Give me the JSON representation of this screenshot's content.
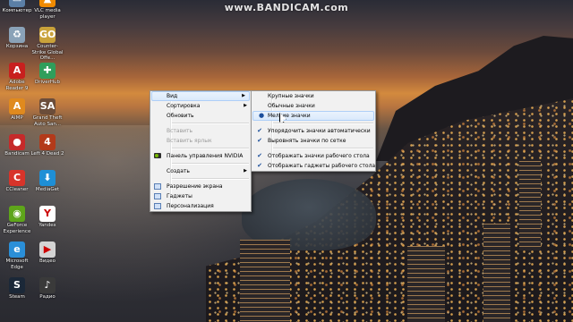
{
  "watermark": "www.BANDICAM.com",
  "desktop_icons": [
    {
      "label": "Компьютер",
      "icon": "computer-icon",
      "color": "#5b7fa6",
      "glyph": "▭"
    },
    {
      "label": "VLC media player",
      "icon": "vlc-icon",
      "color": "#f08a00",
      "glyph": "▲"
    },
    {
      "label": "Корзина",
      "icon": "recycle-bin-icon",
      "color": "#8aa2b8",
      "glyph": "♻"
    },
    {
      "label": "Counter-Strike Global Offe...",
      "icon": "counter-strike-icon",
      "color": "#c9a23a",
      "glyph": "GO"
    },
    {
      "label": "Adobe Reader 9",
      "icon": "adobe-reader-icon",
      "color": "#c8201e",
      "glyph": "A"
    },
    {
      "label": "DriverHub",
      "icon": "driverhub-icon",
      "color": "#2f9e5b",
      "glyph": "✚"
    },
    {
      "label": "AIMP",
      "icon": "aimp-icon",
      "color": "#e08a1e",
      "glyph": "A"
    },
    {
      "label": "Grand Theft Auto San...",
      "icon": "gta-icon",
      "color": "#6b4d3a",
      "glyph": "SA"
    },
    {
      "label": "Bandicam",
      "icon": "bandicam-icon",
      "color": "#c62a2a",
      "glyph": "●"
    },
    {
      "label": "Left 4 Dead 2",
      "icon": "left4dead-icon",
      "color": "#b33a1a",
      "glyph": "4"
    },
    {
      "label": "CCleaner",
      "icon": "ccleaner-icon",
      "color": "#d8342a",
      "glyph": "C"
    },
    {
      "label": "MediaGet",
      "icon": "mediaget-icon",
      "color": "#1e8fd6",
      "glyph": "⬇"
    },
    {
      "label": "GeForce Experience",
      "icon": "geforce-icon",
      "color": "#5ea51a",
      "glyph": "◉"
    },
    {
      "label": "Yandex",
      "icon": "yandex-icon",
      "color": "#ffffff",
      "glyph": "Y"
    },
    {
      "label": "Microsoft Edge",
      "icon": "edge-icon",
      "color": "#2a8fd8",
      "glyph": "e"
    },
    {
      "label": "Видео",
      "icon": "video-icon",
      "color": "#d4d4d4",
      "glyph": "▶"
    },
    {
      "label": "Steam",
      "icon": "steam-icon",
      "color": "#1b2838",
      "glyph": "S"
    },
    {
      "label": "Радио",
      "icon": "radio-icon",
      "color": "#3a3a3a",
      "glyph": "♪"
    }
  ],
  "context_menu": {
    "items": [
      {
        "label": "Вид",
        "submenu": true,
        "highlighted": true
      },
      {
        "label": "Сортировка",
        "submenu": true
      },
      {
        "label": "Обновить"
      },
      {
        "separator": true
      },
      {
        "label": "Вставить",
        "disabled": true
      },
      {
        "label": "Вставить ярлык",
        "disabled": true
      },
      {
        "separator": true
      },
      {
        "label": "Панель управления NVIDIA",
        "icon": "nvidia-icon"
      },
      {
        "separator": true
      },
      {
        "label": "Создать",
        "submenu": true
      },
      {
        "separator": true
      },
      {
        "label": "Разрешение экрана",
        "icon": "screen-resolution-icon"
      },
      {
        "label": "Гаджеты",
        "icon": "gadgets-icon"
      },
      {
        "label": "Персонализация",
        "icon": "personalization-icon"
      }
    ]
  },
  "view_submenu": {
    "items": [
      {
        "label": "Крупные значки"
      },
      {
        "label": "Обычные значки"
      },
      {
        "label": "Мелкие значки",
        "radio": true,
        "highlighted": true
      },
      {
        "separator": true
      },
      {
        "label": "Упорядочить значки автоматически",
        "checked": true
      },
      {
        "label": "Выровнять значки по сетке",
        "checked": true
      },
      {
        "separator": true
      },
      {
        "label": "Отображать значки рабочего стола",
        "checked": true
      },
      {
        "label": "Отображать гаджеты рабочего стола",
        "checked": true
      }
    ]
  },
  "colors": {
    "menu_bg": "#f1f1f1",
    "highlight": "#d9e9fb",
    "check": "#1c4f9c"
  }
}
